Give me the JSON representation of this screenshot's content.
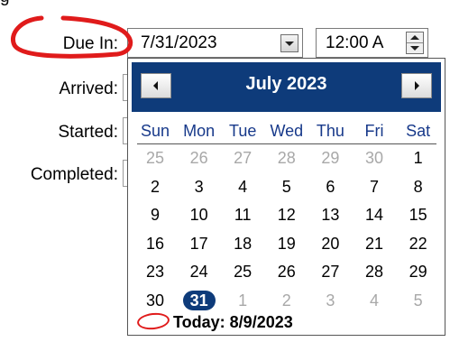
{
  "fields": {
    "due_label": "Due In:",
    "arrived_label": "Arrived:",
    "started_label": "Started:",
    "completed_label": "Completed:",
    "due_date_value": "7/31/2023",
    "due_time_value": "12:00 A"
  },
  "calendar": {
    "month_title": "July 2023",
    "weekdays": [
      "Sun",
      "Mon",
      "Tue",
      "Wed",
      "Thu",
      "Fri",
      "Sat"
    ],
    "weeks": [
      [
        {
          "d": "25",
          "other": true
        },
        {
          "d": "26",
          "other": true
        },
        {
          "d": "27",
          "other": true
        },
        {
          "d": "28",
          "other": true
        },
        {
          "d": "29",
          "other": true
        },
        {
          "d": "30",
          "other": true
        },
        {
          "d": "1"
        }
      ],
      [
        {
          "d": "2"
        },
        {
          "d": "3"
        },
        {
          "d": "4"
        },
        {
          "d": "5"
        },
        {
          "d": "6"
        },
        {
          "d": "7"
        },
        {
          "d": "8"
        }
      ],
      [
        {
          "d": "9"
        },
        {
          "d": "10"
        },
        {
          "d": "11"
        },
        {
          "d": "12"
        },
        {
          "d": "13"
        },
        {
          "d": "14"
        },
        {
          "d": "15"
        }
      ],
      [
        {
          "d": "16"
        },
        {
          "d": "17"
        },
        {
          "d": "18"
        },
        {
          "d": "19"
        },
        {
          "d": "20"
        },
        {
          "d": "21"
        },
        {
          "d": "22"
        }
      ],
      [
        {
          "d": "23"
        },
        {
          "d": "24"
        },
        {
          "d": "25"
        },
        {
          "d": "26"
        },
        {
          "d": "27"
        },
        {
          "d": "28"
        },
        {
          "d": "29"
        }
      ],
      [
        {
          "d": "30"
        },
        {
          "d": "31",
          "selected": true
        },
        {
          "d": "1",
          "other": true
        },
        {
          "d": "2",
          "other": true
        },
        {
          "d": "3",
          "other": true
        },
        {
          "d": "4",
          "other": true
        },
        {
          "d": "5",
          "other": true
        }
      ]
    ],
    "today_label": "Today: 8/9/2023"
  },
  "colors": {
    "header_bg": "#0e3b7a",
    "weekday_text": "#17398a",
    "selected_bg": "#0e3b7a",
    "annotation_red": "#e01b1b"
  }
}
